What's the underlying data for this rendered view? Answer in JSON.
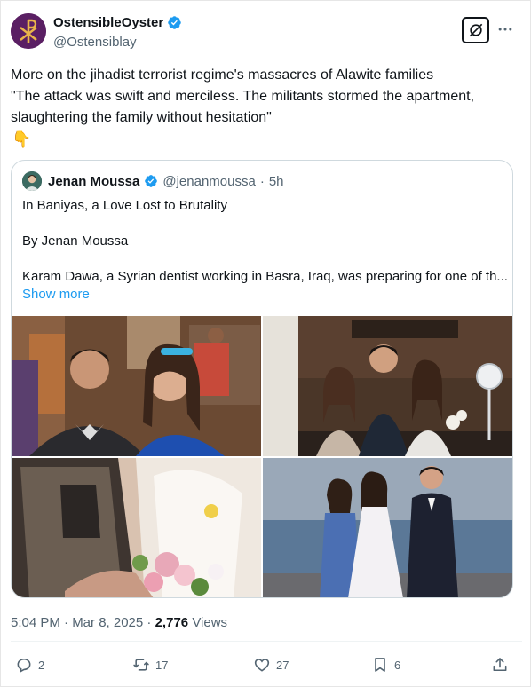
{
  "post": {
    "author": {
      "display_name": "OstensibleOyster",
      "handle": "@Ostensiblay",
      "verified": true,
      "avatar_icon": "chi-rho-icon",
      "avatar_color": "#5a1f63"
    },
    "text_lines": [
      "More on the jihadist terrorist regime's massacres of Alawite families",
      "\"The attack was swift and merciless. The militants stormed the apartment,",
      "slaughtering the family without hesitation\""
    ],
    "emoji": "👇",
    "quoted": {
      "display_name": "Jenan Moussa",
      "handle": "@jenanmoussa",
      "separator": "·",
      "time_ago": "5h",
      "verified": true,
      "lines": [
        "In Baniyas, a Love Lost to Brutality",
        "By Jenan Moussa",
        "Karam Dawa, a Syrian dentist working in Basra, Iraq, was preparing for one of th..."
      ],
      "show_more": "Show more",
      "photos": [
        "photo-couple-selfie",
        "photo-group-restaurant",
        "photo-bouquet-close-up",
        "photo-wedding-group"
      ]
    },
    "timestamp": "5:04 PM · Mar 8, 2025",
    "meta_sep": " · ",
    "views_count": "2,776",
    "views_label": "Views",
    "actions": {
      "replies": "2",
      "reposts": "17",
      "likes": "27",
      "bookmarks": "6"
    },
    "colors": {
      "verified": "#1d9bf0",
      "link": "#1d9bf0",
      "muted": "#536471"
    }
  }
}
